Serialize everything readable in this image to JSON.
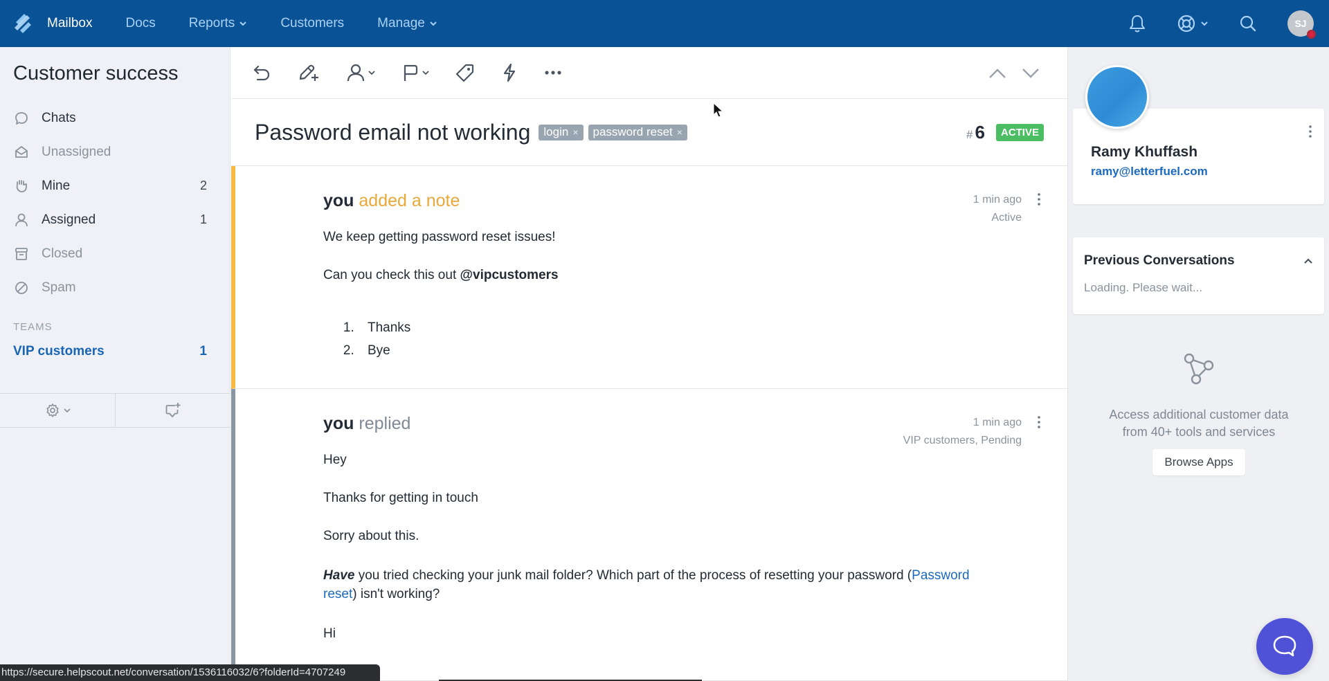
{
  "topnav": {
    "items": [
      {
        "label": "Mailbox",
        "active": true,
        "dropdown": false
      },
      {
        "label": "Docs",
        "active": false,
        "dropdown": false
      },
      {
        "label": "Reports",
        "active": false,
        "dropdown": true
      },
      {
        "label": "Customers",
        "active": false,
        "dropdown": false
      },
      {
        "label": "Manage",
        "active": false,
        "dropdown": true
      }
    ],
    "right_icons": [
      "bell-icon",
      "help-lifebuoy-icon",
      "search-icon"
    ],
    "user_initials": "SJ",
    "colors": {
      "bar": "#0a5296",
      "link": "#a9d2f5",
      "active": "#ffffff"
    }
  },
  "sidebar": {
    "mailbox_title": "Customer success",
    "folders": [
      {
        "label": "Chats",
        "icon": "chat-bubble-icon",
        "count": ""
      },
      {
        "label": "Unassigned",
        "icon": "open-envelope-icon",
        "count": ""
      },
      {
        "label": "Mine",
        "icon": "hand-icon",
        "count": "2"
      },
      {
        "label": "Assigned",
        "icon": "user-icon",
        "count": "1"
      },
      {
        "label": "Closed",
        "icon": "archive-box-icon",
        "count": ""
      },
      {
        "label": "Spam",
        "icon": "ban-icon",
        "count": ""
      }
    ],
    "teams_label": "TEAMS",
    "teams": [
      {
        "label": "VIP customers",
        "count": "1"
      }
    ],
    "footer": {
      "settings_icon": "gear-icon",
      "new_convo_icon": "new-conversation-icon"
    }
  },
  "toolbar": {
    "actions": [
      "undo-icon",
      "note-pencil-plus-icon",
      "assign-user-icon",
      "status-flag-icon",
      "tag-icon",
      "workflow-bolt-icon",
      "more-icon"
    ],
    "nav": [
      "previous-conversation",
      "next-conversation"
    ]
  },
  "conversation": {
    "subject": "Password email not working",
    "tags": [
      {
        "label": "login",
        "remove": "×"
      },
      {
        "label": "password reset",
        "remove": "×"
      }
    ],
    "hash": "#",
    "number": "6",
    "status": "ACTIVE",
    "status_color": "#4bbd62",
    "threads": [
      {
        "type": "note",
        "who": "you",
        "action": "added a note",
        "time": "1 min ago",
        "meta": "Active",
        "body": {
          "p1": "We keep getting password reset issues!",
          "p2_text": "Can you check this out ",
          "p2_mention": "@vipcustomers",
          "list": [
            "Thanks",
            "Bye"
          ]
        },
        "accent": "#f5b944"
      },
      {
        "type": "reply",
        "who": "you",
        "action": "replied",
        "time": "1 min ago",
        "meta": "VIP customers, Pending",
        "body": {
          "p1": "Hey",
          "p2": "Thanks for getting in touch",
          "p3": "Sorry about this.",
          "p4_bold": "Have",
          "p4_text": " you tried checking your junk mail folder? Which part of the process of resetting your password (",
          "p4_link": "Password reset",
          "p4_tail": ") isn't working?",
          "p5": "Hi"
        },
        "accent": "#8a95a3"
      }
    ]
  },
  "customer": {
    "name": "Ramy Khuffash",
    "email": "ramy@letterfuel.com",
    "previous_title": "Previous Conversations",
    "previous_loading": "Loading. Please wait...",
    "apps_text_line1": "Access additional customer data",
    "apps_text_line2": "from 40+ tools and services",
    "browse_label": "Browse Apps"
  },
  "beacon": {
    "icon": "chat-bubble-icon",
    "color": "#4f51d6"
  },
  "status_url": "https://secure.helpscout.net/conversation/1536116032/6?folderId=4707249"
}
